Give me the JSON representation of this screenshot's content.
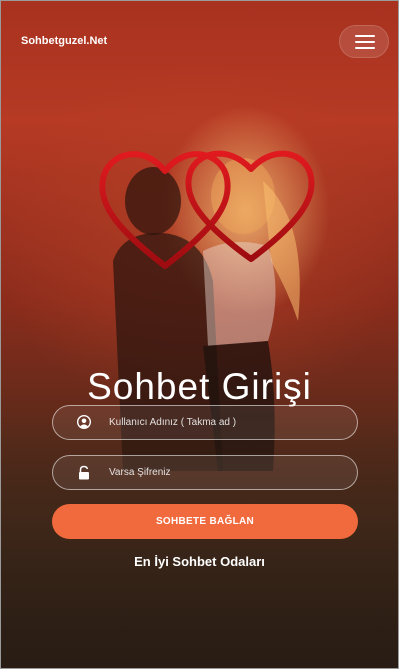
{
  "header": {
    "brand": "Sohbetguzel.Net",
    "menu_icon": "hamburger-menu-icon"
  },
  "hero": {
    "decoration_icon": "double-heart-icon",
    "title": "Sohbet Girişi"
  },
  "form": {
    "username": {
      "icon": "user-icon",
      "placeholder": "Kullanıcı Adınız ( Takma ad )",
      "value": ""
    },
    "password": {
      "icon": "lock-icon",
      "placeholder": "Varsa Şifreniz",
      "value": ""
    },
    "submit_label": "SOHBETE BAĞLAN"
  },
  "footer": {
    "rooms_link": "En İyi Sohbet Odaları"
  },
  "colors": {
    "accent": "#f06a3d",
    "heart": "#d0121a",
    "text": "#ffffff"
  }
}
